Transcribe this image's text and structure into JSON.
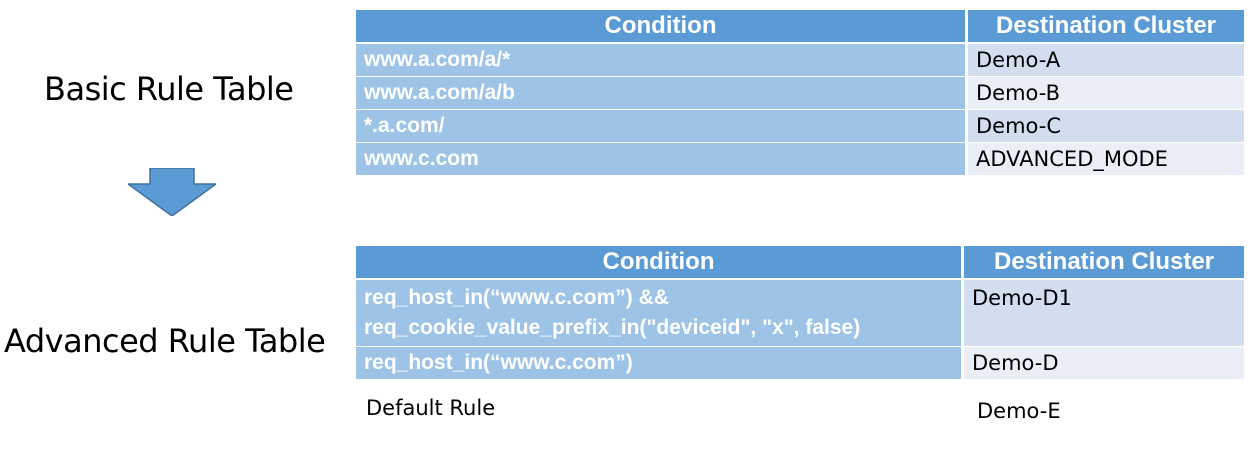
{
  "basic": {
    "label": "Basic Rule Table",
    "headers": {
      "condition": "Condition",
      "destination": "Destination Cluster"
    },
    "rows": [
      {
        "condition": "www.a.com/a/*",
        "destination": "Demo-A"
      },
      {
        "condition": "www.a.com/a/b",
        "destination": "Demo-B"
      },
      {
        "condition": "*.a.com/",
        "destination": "Demo-C"
      },
      {
        "condition": "www.c.com",
        "destination": "ADVANCED_MODE"
      }
    ]
  },
  "advanced": {
    "label": "Advanced Rule Table",
    "headers": {
      "condition": "Condition",
      "destination": "Destination Cluster"
    },
    "rows": [
      {
        "condition_line1": "req_host_in(“www.c.com”) &&",
        "condition_line2": "req_cookie_value_prefix_in(\"deviceid\", \"x\", false)",
        "destination": "Demo-D1"
      },
      {
        "condition": "req_host_in(“www.c.com”)",
        "destination": "Demo-D"
      }
    ],
    "default_rule": {
      "condition": "Default Rule",
      "destination": "Demo-E"
    }
  },
  "colors": {
    "header": "#5b9bd5",
    "condition_cell": "#9dc3e6",
    "dest_cell_odd": "#d2deef",
    "dest_cell_even": "#eaeff7",
    "arrow": "#5b9bd5"
  },
  "icons": {
    "flow": "down-arrow-icon"
  }
}
